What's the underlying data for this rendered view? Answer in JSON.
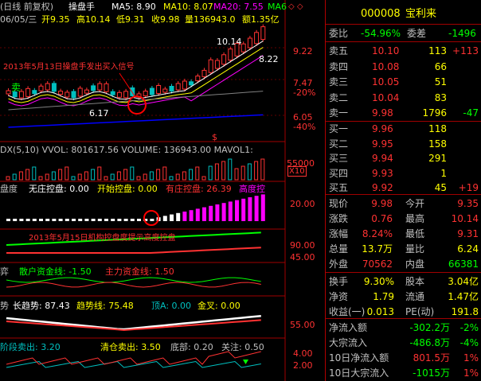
{
  "chart": {
    "period_label": "(日线 前复权)",
    "indicator_name": "操盘手",
    "ma5": "MA5: 8.90",
    "ma10": "MA10: 8.07",
    "ma20": "MA20: 7.55",
    "ma6_stub": "MA6",
    "date_line": "06/05/三",
    "open": "开9.35",
    "high": "高10.14",
    "low": "低9.31",
    "close": "收9.98",
    "volume": "量136943.0",
    "amount": "额1.35亿",
    "price_high_label": "10.14",
    "price_low_label": "6.17",
    "price_last_label": "8.22",
    "annotation_buy": "2013年5月13日操盘手发出买入信号",
    "buy_marker": "卖",
    "dollar_marker": "$",
    "vol_header": "DX(5,10)  VVOL: 801617.56  VOLUME: 136943.00  MAVOL1:",
    "x10_label": "X10",
    "ctrl_label": "盘度",
    "ctrl_no": "无庄控盘: 0.00",
    "ctrl_start": "开始控盘: 0.00",
    "ctrl_has": "有庄控盘: 26.39",
    "ctrl_high": "高度控",
    "annotation_ctrl": "2013年5月15日机构控盘度提示高度控盘",
    "fund_label": "弈",
    "fund_retail": "散户资金线: -1.50",
    "fund_main": "主力资金线: 1.50",
    "trend_label": "势",
    "trend_long": "长趋势: 87.43",
    "trend_line": "趋势线: 75.48",
    "trend_top": "顶A: 0.00",
    "trend_cross": "金叉: 0.00",
    "sell_label": "阶段卖出: 3.20",
    "sell_clear": "清仓卖出: 3.50",
    "sell_bottom": "底部: 0.20",
    "sell_watch": "关注: 0.50",
    "right_axis": {
      "p1": "9.22",
      "p2": "7.47",
      "p2pct": "-20%",
      "p3": "6.05",
      "p3pct": "-40%",
      "v1": "55000",
      "c1": "20.00",
      "f1": "90.00",
      "f2": "45.00",
      "t1": "55.00",
      "s1": "4.00",
      "s2": "2.00"
    }
  },
  "quote": {
    "code": "000008",
    "name": "宝利来",
    "weibi_label": "委比",
    "weibi_value": "-54.96%",
    "weicha_label": "委差",
    "weicha_value": "-1496",
    "sells": [
      {
        "label": "卖五",
        "price": "10.10",
        "vol": "113",
        "chg": "+113"
      },
      {
        "label": "卖四",
        "price": "10.08",
        "vol": "66",
        "chg": ""
      },
      {
        "label": "卖三",
        "price": "10.05",
        "vol": "51",
        "chg": ""
      },
      {
        "label": "卖二",
        "price": "10.04",
        "vol": "83",
        "chg": ""
      },
      {
        "label": "卖一",
        "price": "9.98",
        "vol": "1796",
        "chg": "-47"
      }
    ],
    "buys": [
      {
        "label": "买一",
        "price": "9.96",
        "vol": "118",
        "chg": ""
      },
      {
        "label": "买二",
        "price": "9.95",
        "vol": "158",
        "chg": ""
      },
      {
        "label": "买三",
        "price": "9.94",
        "vol": "291",
        "chg": ""
      },
      {
        "label": "买四",
        "price": "9.93",
        "vol": "1",
        "chg": ""
      },
      {
        "label": "买五",
        "price": "9.92",
        "vol": "45",
        "chg": "+19"
      }
    ],
    "stats": [
      {
        "l1": "现价",
        "v1": "9.98",
        "l2": "今开",
        "v2": "9.35"
      },
      {
        "l1": "涨跌",
        "v1": "0.76",
        "l2": "最高",
        "v2": "10.14"
      },
      {
        "l1": "涨幅",
        "v1": "8.24%",
        "l2": "最低",
        "v2": "9.31"
      },
      {
        "l1": "总量",
        "v1": "13.7万",
        "l2": "量比",
        "v2": "6.24"
      },
      {
        "l1": "外盘",
        "v1": "70562",
        "l2": "内盘",
        "v2": "66381"
      }
    ],
    "stats2": [
      {
        "l1": "换手",
        "v1": "9.30%",
        "l2": "股本",
        "v2": "3.04亿"
      },
      {
        "l1": "净资",
        "v1": "1.79",
        "l2": "流通",
        "v2": "1.47亿"
      },
      {
        "l1": "收益(一)",
        "v1": "0.013",
        "l2": "PE(动)",
        "v2": "191.8"
      }
    ],
    "flows": [
      {
        "label": "净流入额",
        "value": "-302.2万",
        "pct": "-2%"
      },
      {
        "label": "大宗流入",
        "value": "-486.8万",
        "pct": "-4%"
      },
      {
        "label": "10日净流入额",
        "value": "801.5万",
        "pct": "1%"
      },
      {
        "label": "10日大宗流入",
        "value": "-1015万",
        "pct": "1%"
      }
    ]
  },
  "colors": {
    "up": "#ff3232",
    "down": "#00c0c0",
    "yellow": "#ffff00",
    "white": "#ffffff",
    "magenta": "#ff00ff",
    "green": "#00ff00",
    "grid": "#a00000"
  }
}
